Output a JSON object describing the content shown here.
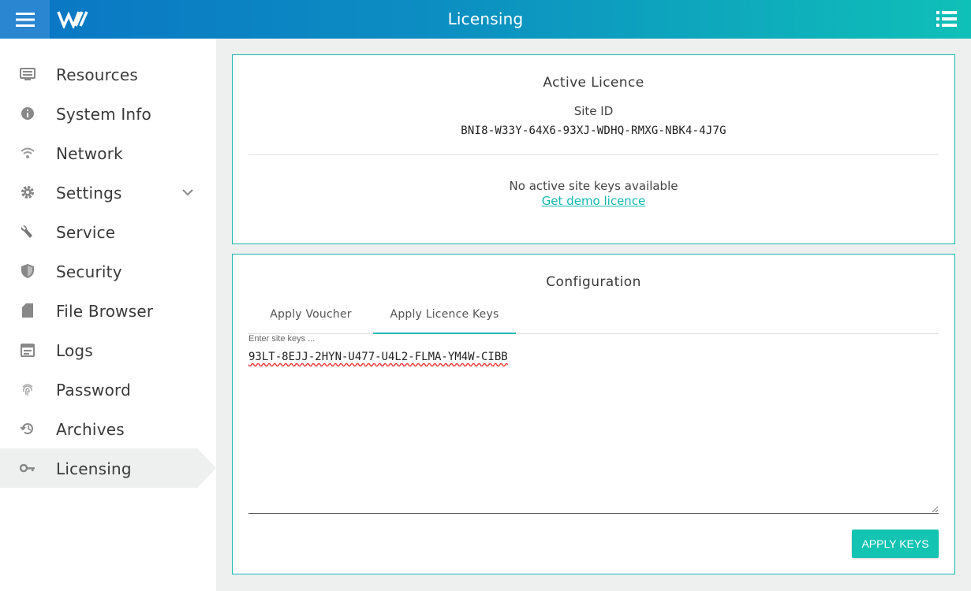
{
  "header": {
    "title": "Licensing",
    "menu_icon": "hamburger-icon",
    "logo_icon": "brand-logo",
    "list_icon": "list-icon",
    "gradient": [
      "#0a75c4",
      "#0fc0b8"
    ]
  },
  "sidebar": {
    "items": [
      {
        "label": "Resources",
        "icon": "monitor-icon"
      },
      {
        "label": "System Info",
        "icon": "info-icon"
      },
      {
        "label": "Network",
        "icon": "wifi-icon"
      },
      {
        "label": "Settings",
        "icon": "gear-icon",
        "expandable": true
      },
      {
        "label": "Service",
        "icon": "wrench-icon"
      },
      {
        "label": "Security",
        "icon": "shield-icon"
      },
      {
        "label": "File Browser",
        "icon": "sd-card-icon"
      },
      {
        "label": "Logs",
        "icon": "calendar-icon"
      },
      {
        "label": "Password",
        "icon": "fingerprint-icon"
      },
      {
        "label": "Archives",
        "icon": "history-icon"
      },
      {
        "label": "Licensing",
        "icon": "key-icon",
        "active": true
      }
    ]
  },
  "active_licence": {
    "title": "Active Licence",
    "site_id_label": "Site ID",
    "site_id": "BNI8-W33Y-64X6-93XJ-WDHQ-RMXG-NBK4-4J7G",
    "no_keys_text": "No active site keys available",
    "demo_link": "Get demo licence"
  },
  "configuration": {
    "title": "Configuration",
    "tabs": [
      {
        "label": "Apply Voucher",
        "active": false
      },
      {
        "label": "Apply Licence Keys",
        "active": true
      }
    ],
    "input_placeholder": "Enter site keys ...",
    "input_value": "93LT-8EJJ-2HYN-U477-U4L2-FLMA-YM4W-CIBB",
    "apply_button": "APPLY KEYS"
  },
  "colors": {
    "accent": "#14b8b0",
    "button": "#13c4b3"
  }
}
